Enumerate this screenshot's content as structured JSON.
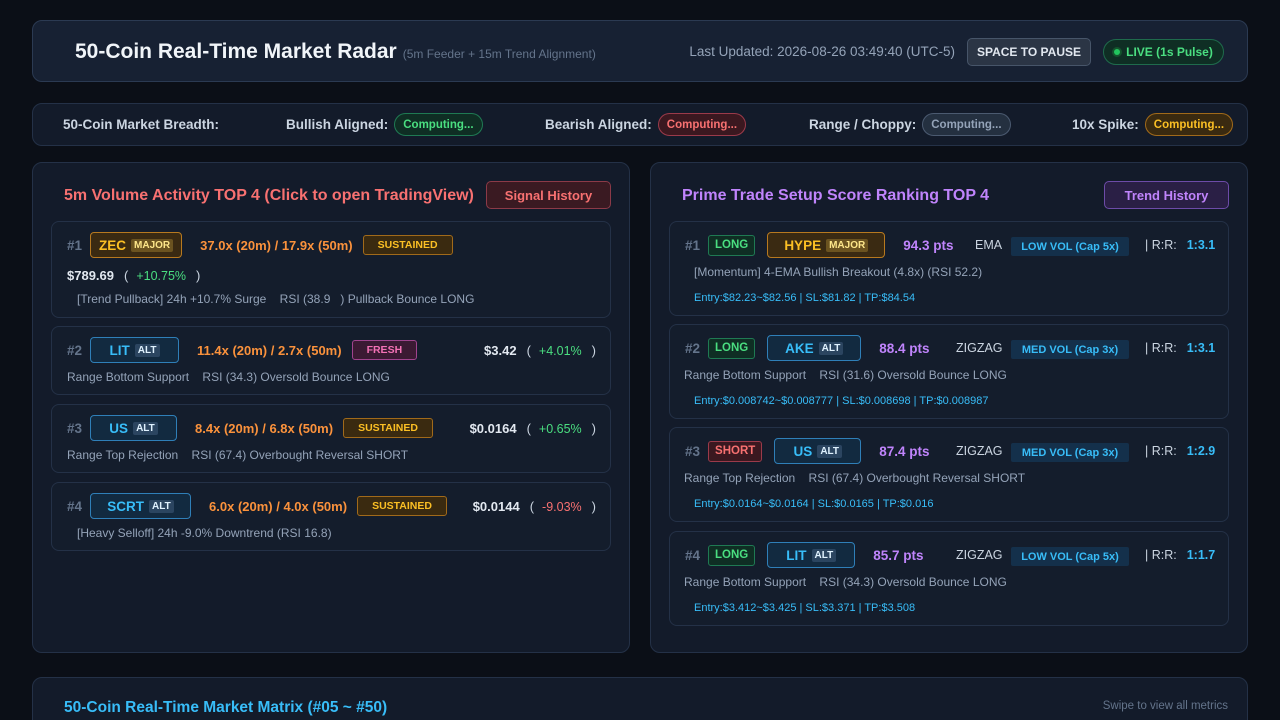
{
  "header": {
    "title": "50-Coin Real-Time Market Radar",
    "subtitle": "(5m Feeder + 15m Trend Alignment)",
    "last_updated": "Last Updated: 2026-08-26 03:49:40 (UTC-5)",
    "pause_label": "SPACE TO PAUSE",
    "live_label": "LIVE (1s Pulse)"
  },
  "breadth": {
    "label": "50-Coin Market Breadth:",
    "bullish_label": "Bullish Aligned:",
    "bullish_value": "Computing...",
    "bearish_label": "Bearish Aligned:",
    "bearish_value": "Computing...",
    "range_label": "Range / Choppy:",
    "range_value": "Computing...",
    "spike_label": "10x Spike:",
    "spike_value": "Computing..."
  },
  "volume_panel": {
    "title": "5m Volume Activity TOP 4 (Click to open TradingView)",
    "history_label": "Signal History",
    "items": [
      {
        "rank": "#1",
        "coin": "ZEC",
        "tag": "MAJOR",
        "mult": "37.0x (20m) / 17.9x (50m)",
        "status": "SUSTAINED",
        "price": "$789.69",
        "change": "+10.75%",
        "desc": "[Trend Pullback] 24h +10.7% Surge    RSI (38.9   ) Pullback Bounce LONG"
      },
      {
        "rank": "#2",
        "coin": "LIT",
        "tag": "ALT",
        "mult": "11.4x (20m) / 2.7x (50m)",
        "status": "FRESH",
        "price": "$3.42",
        "change": "+4.01%",
        "desc": "Range Bottom Support    RSI (34.3) Oversold Bounce LONG"
      },
      {
        "rank": "#3",
        "coin": "US",
        "tag": "ALT",
        "mult": "8.4x (20m) / 6.8x (50m)",
        "status": "SUSTAINED",
        "price": "$0.0164",
        "change": "+0.65%",
        "desc": "Range Top Rejection    RSI (67.4) Overbought Reversal SHORT"
      },
      {
        "rank": "#4",
        "coin": "SCRT",
        "tag": "ALT",
        "mult": "6.0x (20m) / 4.0x (50m)",
        "status": "SUSTAINED",
        "price": "$0.0144",
        "change": "-9.03%",
        "desc": "[Heavy Selloff] 24h -9.0% Downtrend (RSI 16.8)"
      }
    ]
  },
  "setup_panel": {
    "title": "Prime Trade Setup Score Ranking TOP 4",
    "history_label": "Trend History",
    "rr_label": "| R:R:",
    "items": [
      {
        "rank": "#1",
        "direction": "LONG",
        "coin": "HYPE",
        "tag": "MAJOR",
        "score": "94.3 pts",
        "method": "EMA",
        "vol": "LOW VOL (Cap 5x)",
        "rr": "1:3.1",
        "desc": "[Momentum] 4-EMA Bullish Breakout (4.8x) (RSI 52.2)",
        "entry": "Entry:$82.23~$82.56 | SL:$81.82 | TP:$84.54"
      },
      {
        "rank": "#2",
        "direction": "LONG",
        "coin": "AKE",
        "tag": "ALT",
        "score": "88.4 pts",
        "method": "ZIGZAG",
        "vol": "MED VOL (Cap 3x)",
        "rr": "1:3.1",
        "desc": "Range Bottom Support    RSI (31.6) Oversold Bounce LONG",
        "entry": "Entry:$0.008742~$0.008777 | SL:$0.008698 | TP:$0.008987"
      },
      {
        "rank": "#3",
        "direction": "SHORT",
        "coin": "US",
        "tag": "ALT",
        "score": "87.4 pts",
        "method": "ZIGZAG",
        "vol": "MED VOL (Cap 3x)",
        "rr": "1:2.9",
        "desc": "Range Top Rejection    RSI (67.4) Overbought Reversal SHORT",
        "entry": "Entry:$0.0164~$0.0164 | SL:$0.0165 | TP:$0.016"
      },
      {
        "rank": "#4",
        "direction": "LONG",
        "coin": "LIT",
        "tag": "ALT",
        "score": "85.7 pts",
        "method": "ZIGZAG",
        "vol": "LOW VOL (Cap 5x)",
        "rr": "1:1.7",
        "desc": "Range Bottom Support    RSI (34.3) Oversold Bounce LONG",
        "entry": "Entry:$3.412~$3.425 | SL:$3.371 | TP:$3.508"
      }
    ]
  },
  "matrix": {
    "title": "50-Coin Real-Time Market Matrix (#05 ~ #50)",
    "hint": "Swipe to view all metrics"
  }
}
